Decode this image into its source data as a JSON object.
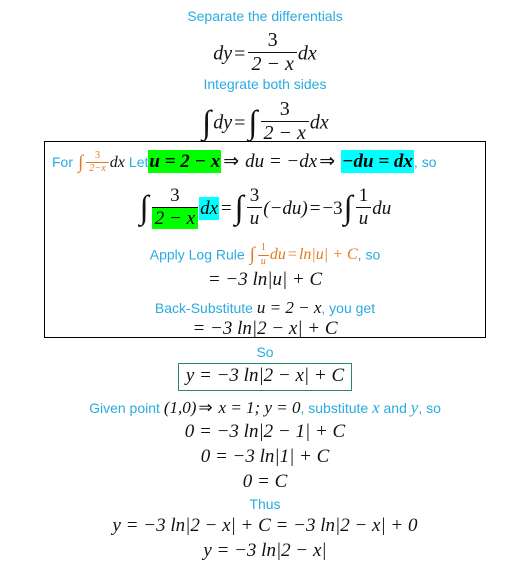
{
  "document": {
    "title": "Separable differential equation worked solution",
    "background": "#ffffff",
    "colors": {
      "hint_text": "#29ABE2",
      "math_text": "#111111",
      "accent_orange": "#E07B1E",
      "highlight_green": "#00FF00",
      "highlight_cyan": "#00FFFF",
      "work_box_border": "#000000",
      "result_box_border": "#2E8B57"
    }
  },
  "steps": {
    "step1_heading": "Separate the differentials",
    "step1_equation": {
      "lhs": "dy",
      "equals": "=",
      "fraction_numerator": "3",
      "fraction_denominator": "2 − x",
      "trailing": "dx"
    },
    "step2_heading": "Integrate both sides",
    "step2_equation": {
      "integral_symbol": "∫",
      "lhs": "dy",
      "equals": "=",
      "fraction_numerator": "3",
      "fraction_denominator": "2 − x",
      "trailing": "dx"
    }
  },
  "work_box": {
    "substitution_line": {
      "prefix": "For",
      "integral_symbol": "∫",
      "fraction_numerator": "3",
      "fraction_denominator": "2−x",
      "differential": "dx",
      "let_word": "Let",
      "u_substitution": "u = 2 − x",
      "implies1": "⇒",
      "du_expression": "du = −dx",
      "implies2": "⇒",
      "dx_expression": "−du = dx",
      "suffix": ", so"
    },
    "rewrite_line": {
      "integral_symbol": "∫",
      "fraction_numerator": "3",
      "fraction_denominator": "2 − x",
      "differential": "dx",
      "equals1": "=",
      "integral_symbol2": "∫",
      "frac2_numerator": "3",
      "frac2_denominator": "u",
      "paren_term": "(−du)",
      "equals2": "=",
      "coefficient": "−3",
      "integral_symbol3": "∫",
      "frac3_numerator": "1",
      "frac3_denominator": "u",
      "differential2": "du"
    },
    "log_rule_line": {
      "prefix": "Apply Log Rule",
      "integral_symbol": "∫",
      "frac_numerator": "1",
      "frac_denominator": "u",
      "differential": "du",
      "equals": "=",
      "result": "ln|u| + C",
      "suffix": ", so"
    },
    "log_rule_result": "= −3 ln|u| + C",
    "back_sub_line": {
      "prefix": "Back-Substitute",
      "equation": "u = 2 − x",
      "suffix": ", you get"
    },
    "back_sub_result": "= −3 ln|2 − x| + C"
  },
  "conclusion": {
    "so_heading": "So",
    "general_solution": "y = −3 ln|2 − x| + C",
    "given_point_line": {
      "prefix": "Given point",
      "point": "(1,0)",
      "implies": "⇒",
      "values": "x = 1; y = 0",
      "middle": ", substitute",
      "var_x": "x",
      "and_word": "and",
      "var_y": "y",
      "suffix": ", so"
    },
    "solve_line1": "0 = −3 ln|2 − 1| + C",
    "solve_line2": "0 = −3 ln|1| + C",
    "solve_line3": "0 = C",
    "thus_heading": "Thus",
    "final_substitute": "y = −3 ln|2 − x| + C = −3 ln|2 − x| + 0",
    "final_answer": "y = −3 ln|2 − x|"
  }
}
